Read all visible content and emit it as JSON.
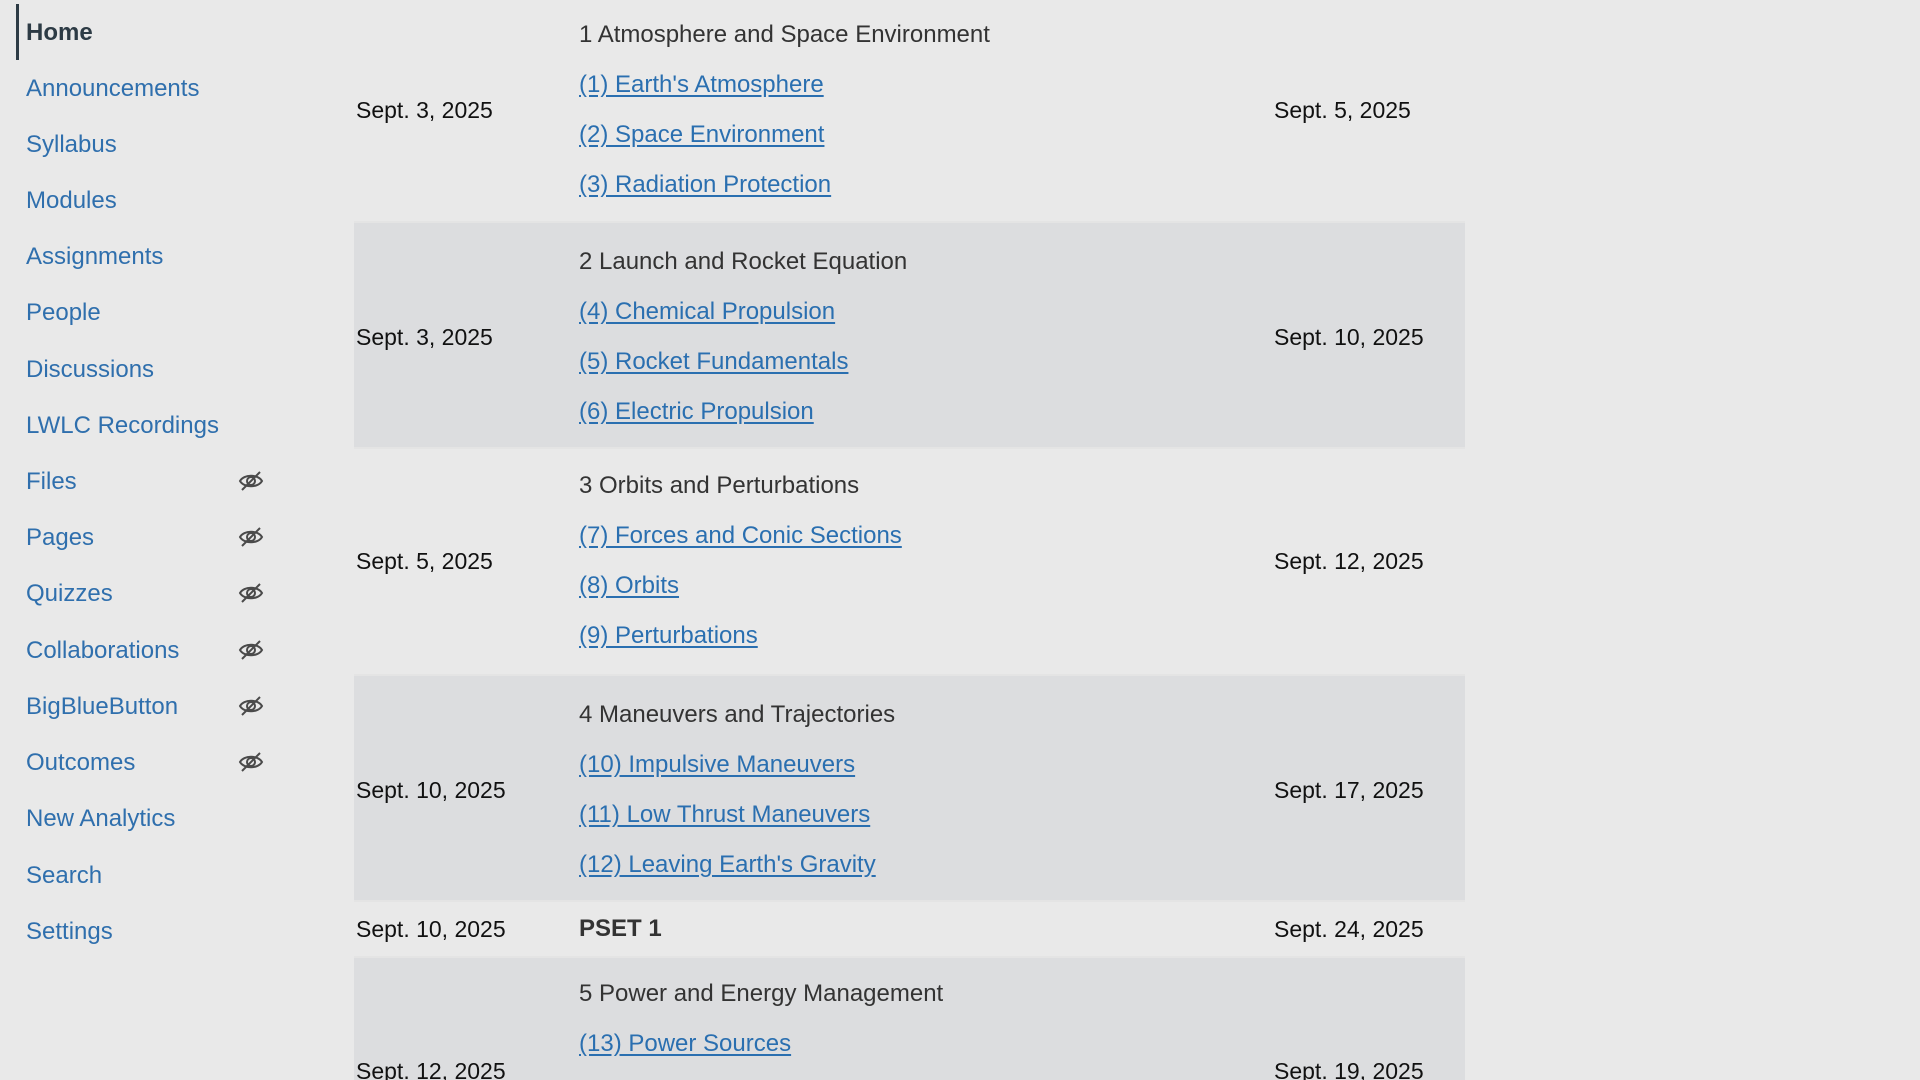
{
  "sidebar": {
    "items": [
      {
        "label": "Home",
        "active": true,
        "hidden_icon": false
      },
      {
        "label": "Announcements",
        "hidden_icon": false
      },
      {
        "label": "Syllabus",
        "hidden_icon": false
      },
      {
        "label": "Modules",
        "hidden_icon": false
      },
      {
        "label": "Assignments",
        "hidden_icon": false
      },
      {
        "label": "People",
        "hidden_icon": false
      },
      {
        "label": "Discussions",
        "hidden_icon": false
      },
      {
        "label": "LWLC Recordings",
        "hidden_icon": false
      },
      {
        "label": "Files",
        "hidden_icon": true
      },
      {
        "label": "Pages",
        "hidden_icon": true
      },
      {
        "label": "Quizzes",
        "hidden_icon": true
      },
      {
        "label": "Collaborations",
        "hidden_icon": true
      },
      {
        "label": "BigBlueButton",
        "hidden_icon": true
      },
      {
        "label": "Outcomes",
        "hidden_icon": true
      },
      {
        "label": "New Analytics",
        "hidden_icon": false
      },
      {
        "label": "Search",
        "hidden_icon": false
      },
      {
        "label": "Settings",
        "hidden_icon": false
      }
    ],
    "hidden_icon_name": "eye-slash-icon"
  },
  "schedule": {
    "rows": [
      {
        "start": "Sept. 3, 2025",
        "title": "1 Atmosphere and Space Environment",
        "links": [
          "(1) Earth's Atmosphere ",
          "(2) Space Environment",
          "(3) Radiation Protection"
        ],
        "end": "Sept. 5, 2025"
      },
      {
        "start": "Sept. 3, 2025",
        "title": "2 Launch and Rocket Equation",
        "links": [
          "(4) Chemical Propulsion",
          "(5) Rocket Fundamentals",
          "(6) Electric Propulsion"
        ],
        "end": "Sept. 10, 2025"
      },
      {
        "start": "Sept. 5, 2025",
        "title": "3 Orbits and Perturbations",
        "links": [
          "(7) Forces and Conic Sections ",
          "(8) Orbits",
          "(9) Perturbations"
        ],
        "end": "Sept. 12, 2025"
      },
      {
        "start": "Sept. 10, 2025",
        "title": "4 Maneuvers and Trajectories",
        "links": [
          "(10) Impulsive Maneuvers",
          "(11) Low Thrust Maneuvers",
          "(12) Leaving Earth's Gravity"
        ],
        "end": "Sept. 17, 2025"
      },
      {
        "start": "Sept. 10, 2025",
        "title": "PSET 1",
        "links": [],
        "end": "Sept. 24, 2025"
      },
      {
        "start": "Sept. 12, 2025",
        "title": "5 Power and Energy Management",
        "links": [
          "(13) Power Sources"
        ],
        "end": "Sept. 19, 2025"
      }
    ]
  }
}
